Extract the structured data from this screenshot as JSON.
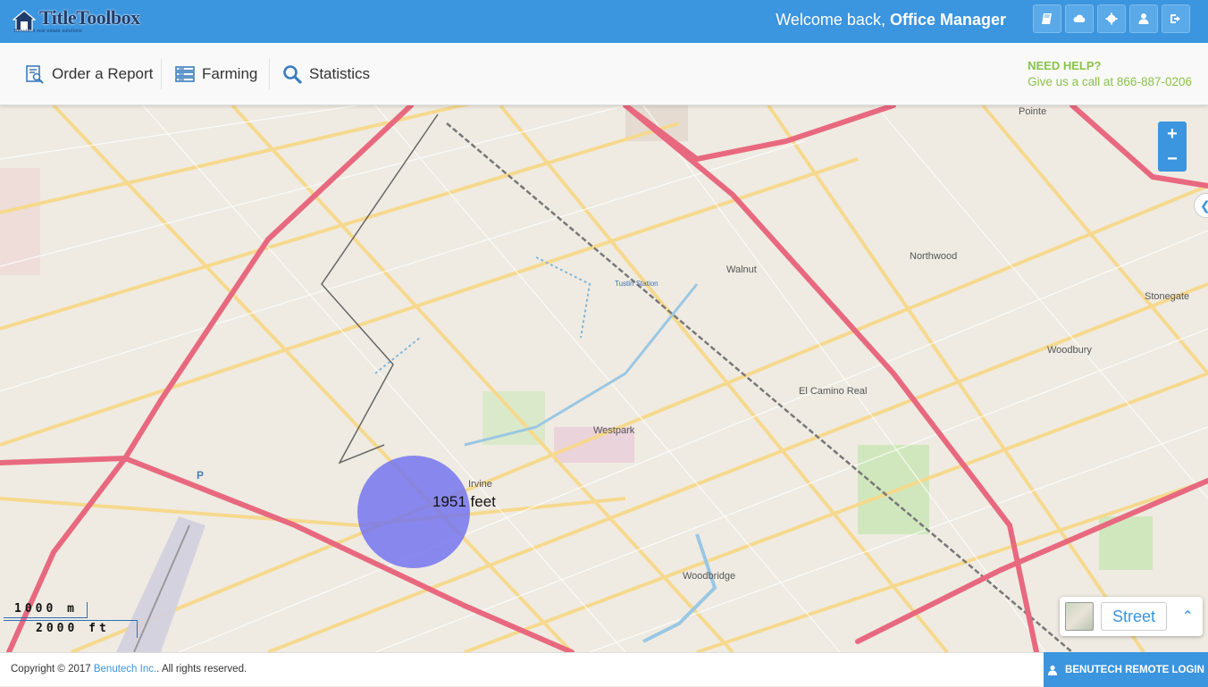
{
  "header": {
    "logo_text": "TitleToolbox",
    "logo_tagline": "Benutech real estate solutions",
    "welcome_prefix": "Welcome back, ",
    "user_role": "Office Manager",
    "icons": [
      "book-icon",
      "cloud-icon",
      "gear-icon",
      "user-icon",
      "logout-icon"
    ]
  },
  "nav": {
    "items": [
      {
        "label": "Order a Report",
        "icon": "report-icon"
      },
      {
        "label": "Farming",
        "icon": "list-icon"
      },
      {
        "label": "Statistics",
        "icon": "search-icon"
      }
    ],
    "help_title": "NEED HELP?",
    "help_text": "Give us a call at 866-887-0206"
  },
  "map": {
    "zoom_in": "+",
    "zoom_out": "−",
    "radius_label": "1951 feet",
    "scale_metric": "1000 m",
    "scale_imperial": "2000 ft",
    "layer_label": "Street",
    "place_labels": [
      "Irvine",
      "Northwood",
      "Walnut",
      "Westpark",
      "El Camino Real",
      "Woodbridge",
      "Woodbury",
      "Stonegate",
      "Tustin Station",
      "Pointe"
    ],
    "colors": {
      "highway": "#e8697f",
      "arterial": "#f7d98a",
      "park": "#c8e6b4",
      "radius": "#6e6ef0",
      "accent": "#3b95df"
    }
  },
  "footer": {
    "copyright_prefix": "Copyright © 2017 ",
    "company_link": "Benutech Inc.",
    "copyright_suffix": ". All rights reserved.",
    "remote_login": "BENUTECH REMOTE LOGIN"
  }
}
